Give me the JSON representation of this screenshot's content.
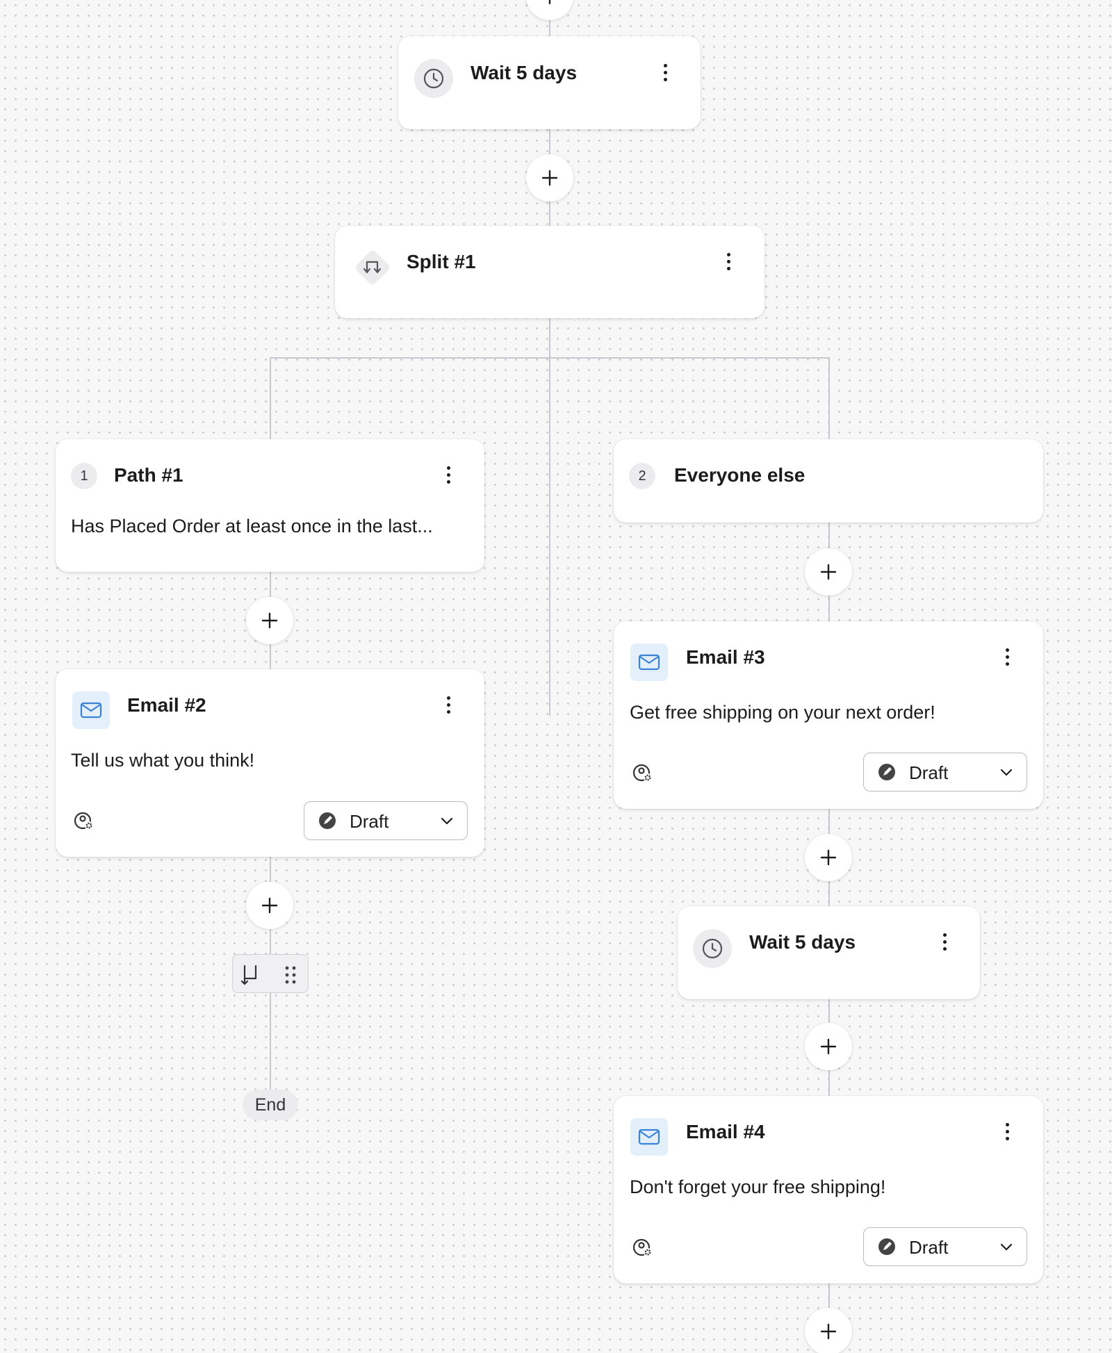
{
  "flow": {
    "wait_top": {
      "title": "Wait 5 days"
    },
    "split": {
      "title": "Split #1"
    },
    "path1": {
      "number": "1",
      "title": "Path #1",
      "description": "Has Placed Order at least once in the last..."
    },
    "path2": {
      "number": "2",
      "title": "Everyone else"
    },
    "email2": {
      "title": "Email #2",
      "description": "Tell us what you think!",
      "status": "Draft"
    },
    "email3": {
      "title": "Email #3",
      "description": "Get free shipping on your next order!",
      "status": "Draft"
    },
    "wait_right": {
      "title": "Wait 5 days"
    },
    "email4": {
      "title": "Email #4",
      "description": "Don't forget your free shipping!",
      "status": "Draft"
    },
    "end_label": "End"
  },
  "colors": {
    "canvas": "#f7f7f8",
    "card": "#ffffff",
    "connector": "#c6c8cd",
    "email_icon": "#3b82d6",
    "email_badge": "#e4effc"
  }
}
